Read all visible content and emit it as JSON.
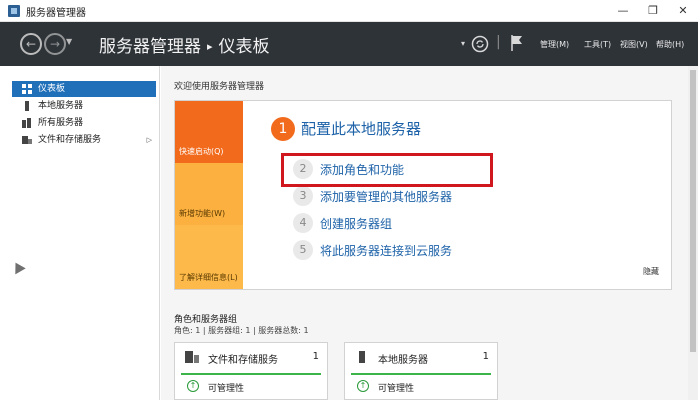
{
  "window": {
    "title": "服务器管理器",
    "minimize": "—",
    "maximize": "❐",
    "close": "✕"
  },
  "header": {
    "breadcrumb_root": "服务器管理器",
    "breadcrumb_sep": "▸",
    "breadcrumb_current": "仪表板",
    "menus": [
      "管理(M)",
      "工具(T)",
      "视图(V)",
      "帮助(H)"
    ]
  },
  "sidebar": {
    "items": [
      {
        "label": "仪表板",
        "active": true
      },
      {
        "label": "本地服务器",
        "active": false
      },
      {
        "label": "所有服务器",
        "active": false
      },
      {
        "label": "文件和存储服务",
        "active": false,
        "expand": "▷"
      }
    ]
  },
  "welcome": {
    "title": "欢迎使用服务器管理器",
    "tabs": [
      "快速启动(Q)",
      "新增功能(W)",
      "了解详细信息(L)"
    ],
    "main_step": {
      "number": "1",
      "label": "配置此本地服务器"
    },
    "steps": [
      {
        "number": "2",
        "label": "添加角色和功能"
      },
      {
        "number": "3",
        "label": "添加要管理的其他服务器"
      },
      {
        "number": "4",
        "label": "创建服务器组"
      },
      {
        "number": "5",
        "label": "将此服务器连接到云服务"
      }
    ],
    "hide": "隐藏"
  },
  "roles": {
    "title": "角色和服务器组",
    "subtitle": "角色: 1 | 服务器组: 1 | 服务器总数: 1",
    "cards": [
      {
        "name": "文件和存储服务",
        "count": "1",
        "status": "可管理性"
      },
      {
        "name": "本地服务器",
        "count": "1",
        "status": "可管理性"
      }
    ]
  },
  "colors": {
    "accent": "#1f6fb9",
    "header_bg": "#2e3338",
    "quickstart_orange": "#f26b1d",
    "tab_yellow": "#fbb040",
    "highlight_red": "#d1171e",
    "status_green": "#3bb44a"
  }
}
